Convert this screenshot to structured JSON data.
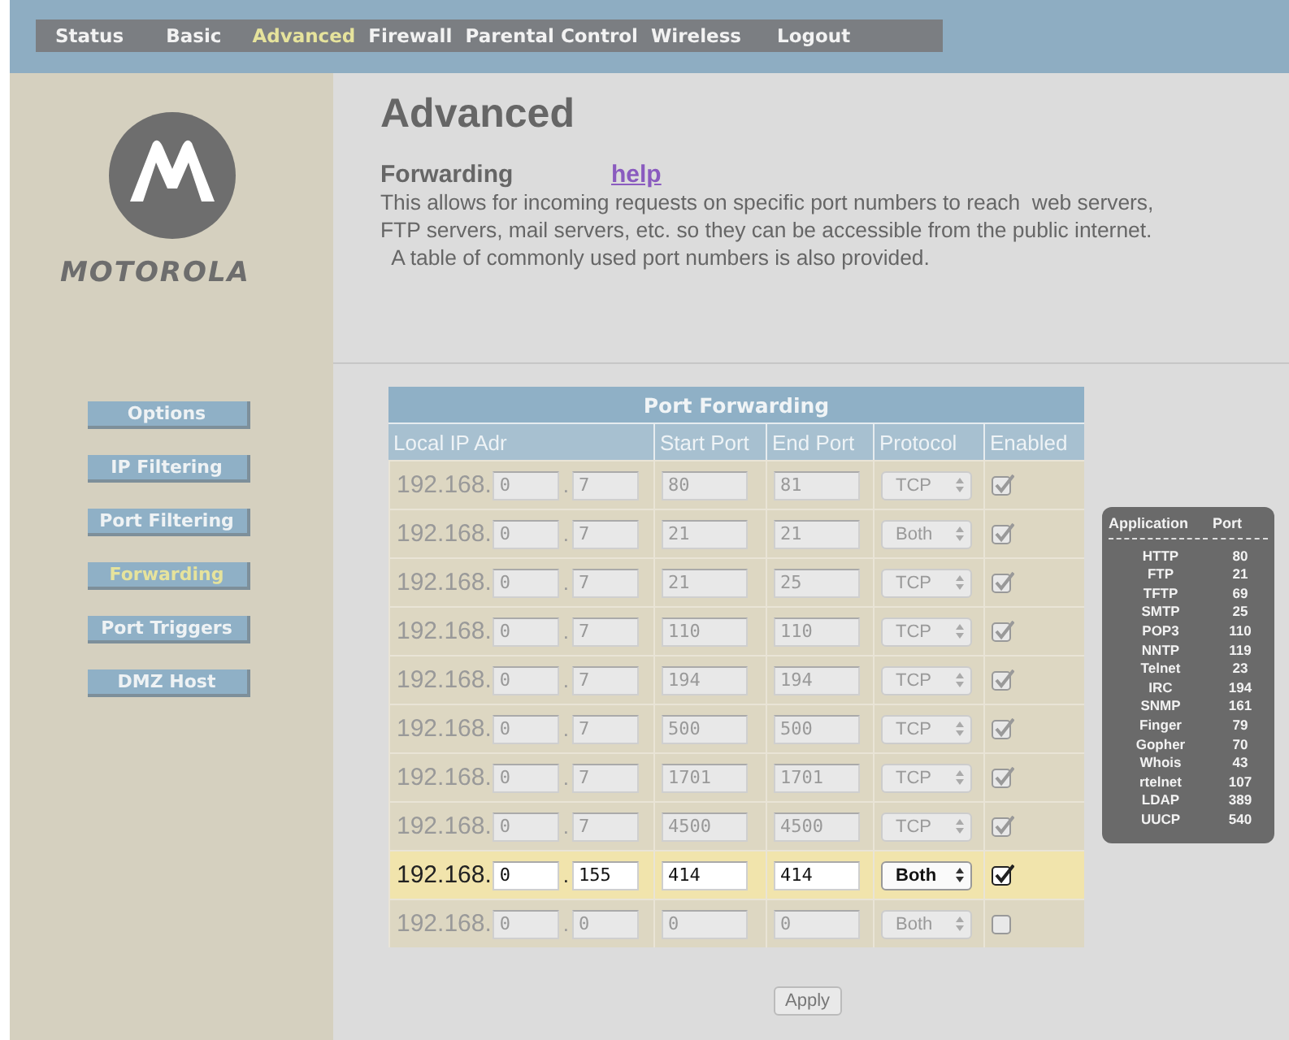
{
  "nav": [
    {
      "label": "Status",
      "selected": false
    },
    {
      "label": "Basic",
      "selected": false
    },
    {
      "label": "Advanced",
      "selected": true
    },
    {
      "label": "Firewall",
      "selected": false
    },
    {
      "label": "Parental Control",
      "selected": false
    },
    {
      "label": "Wireless",
      "selected": false
    },
    {
      "label": "Logout",
      "selected": false
    }
  ],
  "brand": "MOTOROLA",
  "sidebar": [
    {
      "label": "Options",
      "selected": false
    },
    {
      "label": "IP Filtering",
      "selected": false
    },
    {
      "label": "Port Filtering",
      "selected": false
    },
    {
      "label": "Forwarding",
      "selected": true
    },
    {
      "label": "Port Triggers",
      "selected": false
    },
    {
      "label": "DMZ Host",
      "selected": false
    }
  ],
  "heading": "Advanced",
  "section": "Forwarding",
  "help_link": "help",
  "description": [
    "This allows for incoming requests on specific port numbers to reach  web servers,",
    "FTP servers, mail servers, etc. so they can be accessible from the public internet.",
    "  A table of commonly used port numbers is also provided."
  ],
  "table": {
    "title": "Port Forwarding",
    "columns": [
      "Local IP Adr",
      "Start Port",
      "End Port",
      "Protocol",
      "Enabled"
    ],
    "rows": [
      {
        "prefix": "192.168.",
        "ip3": "0",
        "dot": ".",
        "ip4": "7",
        "start": "80",
        "end": "81",
        "protocol": "TCP",
        "enabled": true,
        "highlighted": false
      },
      {
        "prefix": "192.168.",
        "ip3": "0",
        "dot": ".",
        "ip4": "7",
        "start": "21",
        "end": "21",
        "protocol": "Both",
        "enabled": true,
        "highlighted": false
      },
      {
        "prefix": "192.168.",
        "ip3": "0",
        "dot": ".",
        "ip4": "7",
        "start": "21",
        "end": "25",
        "protocol": "TCP",
        "enabled": true,
        "highlighted": false
      },
      {
        "prefix": "192.168.",
        "ip3": "0",
        "dot": ".",
        "ip4": "7",
        "start": "110",
        "end": "110",
        "protocol": "TCP",
        "enabled": true,
        "highlighted": false
      },
      {
        "prefix": "192.168.",
        "ip3": "0",
        "dot": ".",
        "ip4": "7",
        "start": "194",
        "end": "194",
        "protocol": "TCP",
        "enabled": true,
        "highlighted": false
      },
      {
        "prefix": "192.168.",
        "ip3": "0",
        "dot": ".",
        "ip4": "7",
        "start": "500",
        "end": "500",
        "protocol": "TCP",
        "enabled": true,
        "highlighted": false
      },
      {
        "prefix": "192.168.",
        "ip3": "0",
        "dot": ".",
        "ip4": "7",
        "start": "1701",
        "end": "1701",
        "protocol": "TCP",
        "enabled": true,
        "highlighted": false
      },
      {
        "prefix": "192.168.",
        "ip3": "0",
        "dot": ".",
        "ip4": "7",
        "start": "4500",
        "end": "4500",
        "protocol": "TCP",
        "enabled": true,
        "highlighted": false
      },
      {
        "prefix": "192.168.",
        "ip3": "0",
        "dot": ".",
        "ip4": "155",
        "start": "414",
        "end": "414",
        "protocol": "Both",
        "enabled": true,
        "highlighted": true
      },
      {
        "prefix": "192.168.",
        "ip3": "0",
        "dot": ".",
        "ip4": "0",
        "start": "0",
        "end": "0",
        "protocol": "Both",
        "enabled": false,
        "highlighted": false
      }
    ]
  },
  "port_legend": {
    "columns": [
      "Application",
      "Port"
    ],
    "rows": [
      [
        "HTTP",
        "80"
      ],
      [
        "FTP",
        "21"
      ],
      [
        "TFTP",
        "69"
      ],
      [
        "SMTP",
        "25"
      ],
      [
        "POP3",
        "110"
      ],
      [
        "NNTP",
        "119"
      ],
      [
        "Telnet",
        "23"
      ],
      [
        "IRC",
        "194"
      ],
      [
        "SNMP",
        "161"
      ],
      [
        "Finger",
        "79"
      ],
      [
        "Gopher",
        "70"
      ],
      [
        "Whois",
        "43"
      ],
      [
        "rtelnet",
        "107"
      ],
      [
        "LDAP",
        "389"
      ],
      [
        "UUCP",
        "540"
      ]
    ]
  },
  "apply_button": "Apply"
}
